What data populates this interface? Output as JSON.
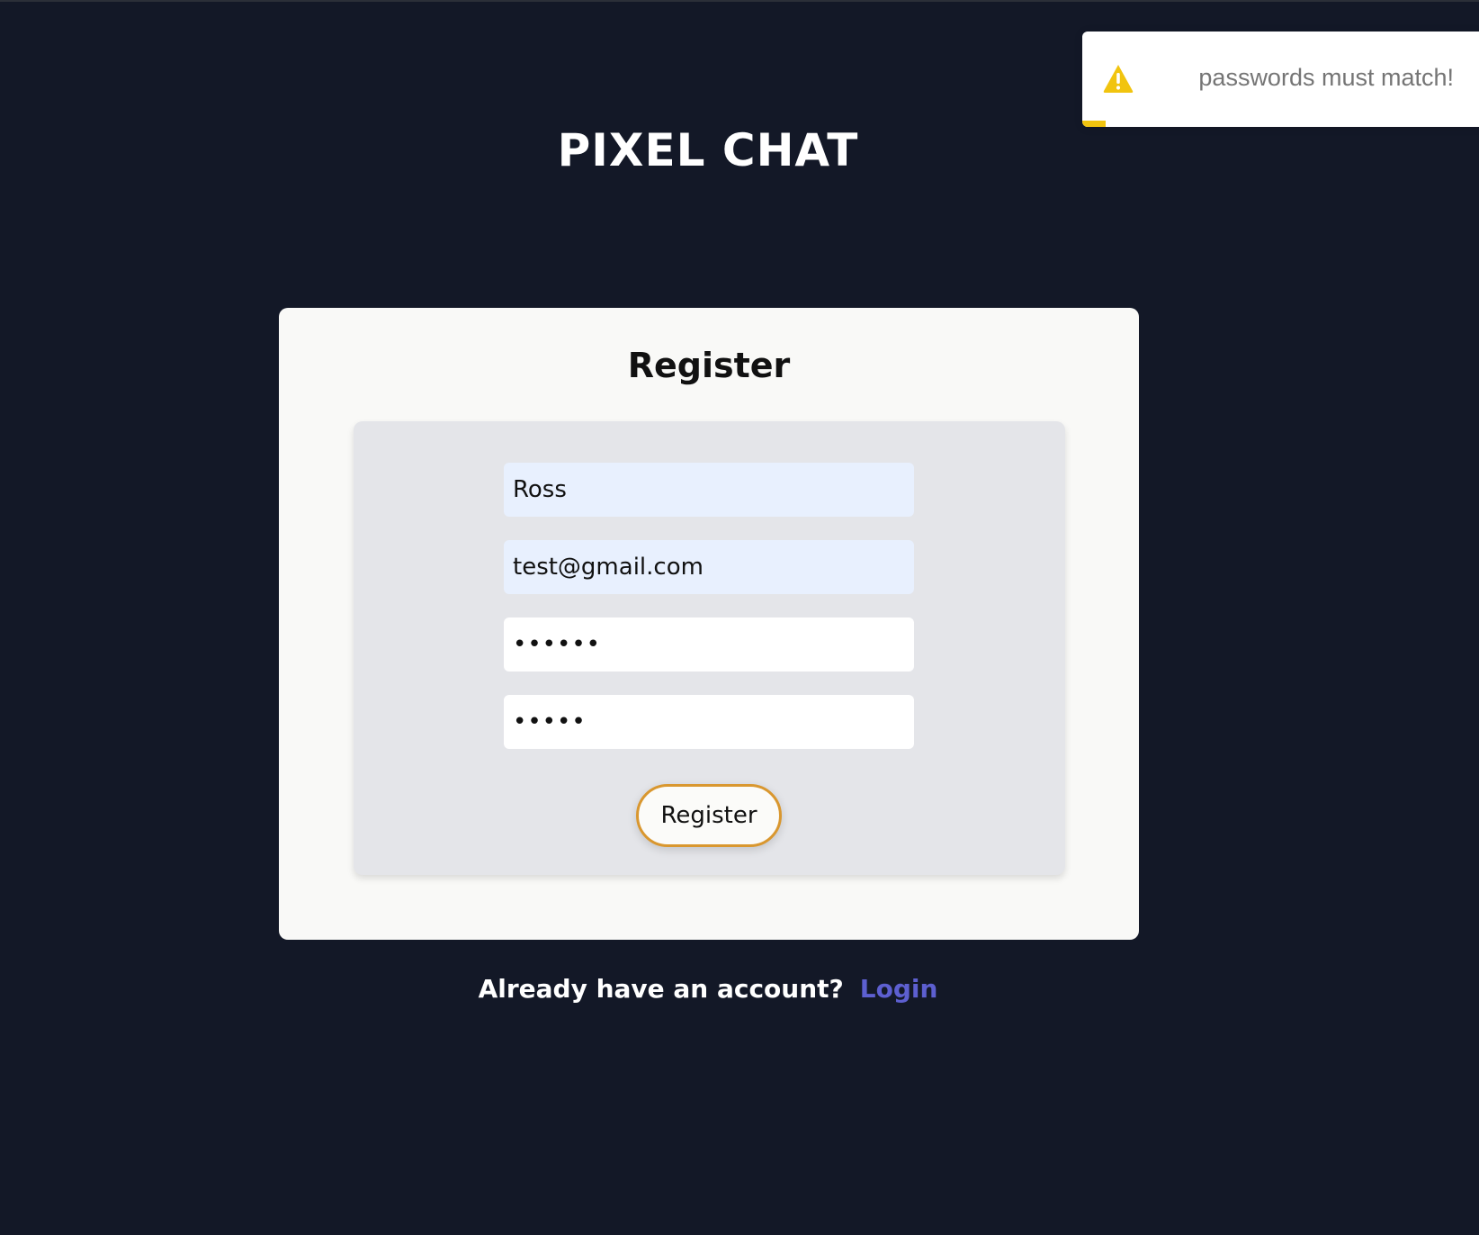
{
  "app": {
    "title": "PIXEL CHAT"
  },
  "register_card": {
    "title": "Register"
  },
  "form": {
    "name_value": "Ross",
    "email_value": "test@gmail.com",
    "password_value": "123456",
    "confirm_password_value": "12345",
    "submit_label": "Register"
  },
  "footer": {
    "prompt": "Already have an account?",
    "login_link": "Login"
  },
  "toast": {
    "type": "warning",
    "icon": "warning-icon",
    "message": "passwords must match!",
    "progress_fraction": 0.06
  },
  "colors": {
    "background": "#131827",
    "card": "#f9f9f7",
    "panel": "#e4e5e9",
    "button_border": "#d9972f",
    "link": "#5d5fd0",
    "warning": "#f1c40f"
  }
}
